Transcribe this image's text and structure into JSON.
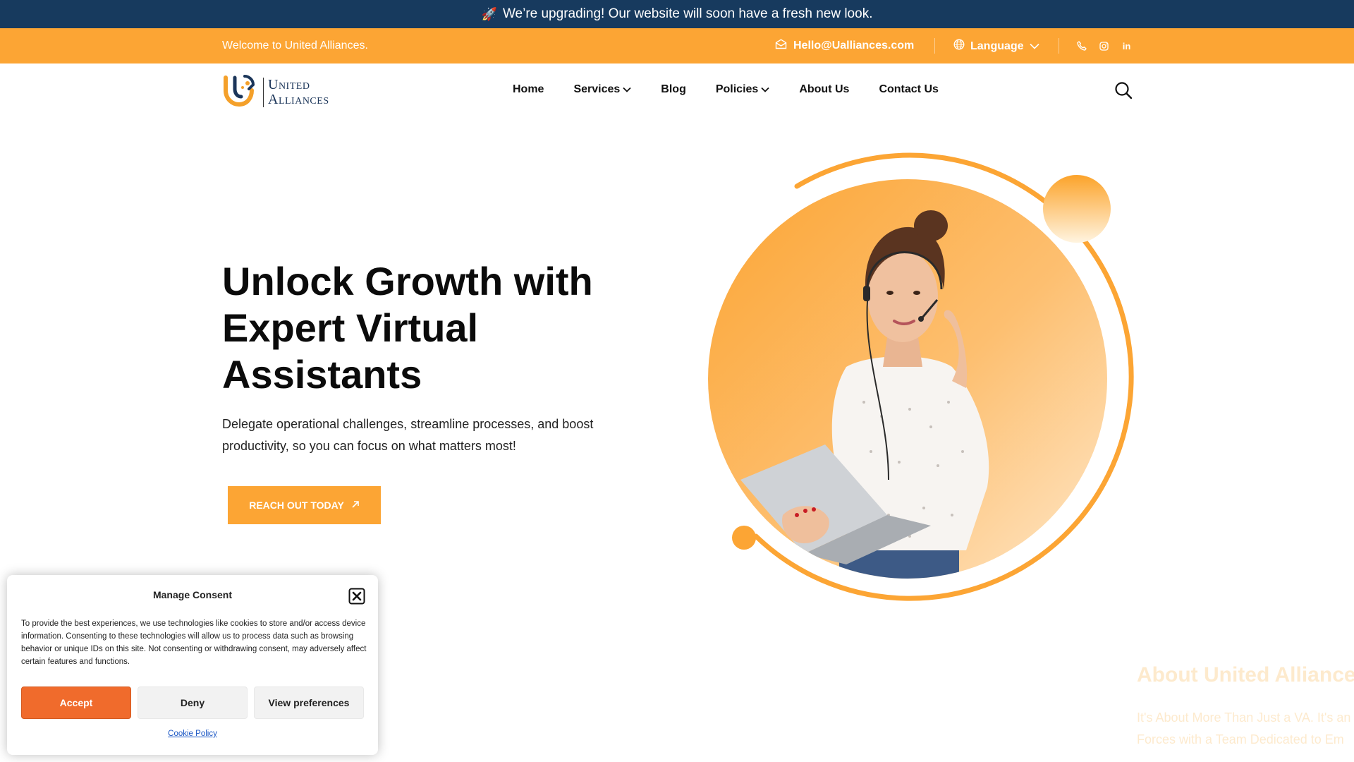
{
  "announcement": {
    "icon": "rocket-icon",
    "text": "We’re upgrading! Our website will soon have a fresh new look."
  },
  "topbar": {
    "welcome": "Welcome to United Alliances.",
    "email": "Hello@Ualliances.com",
    "language": "Language",
    "social": [
      "phone-icon",
      "instagram-icon",
      "linkedin-icon"
    ],
    "linkedin_text": "in"
  },
  "header": {
    "logo_line1": "United",
    "logo_line2": "Alliances",
    "nav": [
      {
        "label": "Home",
        "has_dropdown": false
      },
      {
        "label": "Services",
        "has_dropdown": true
      },
      {
        "label": "Blog",
        "has_dropdown": false
      },
      {
        "label": "Policies",
        "has_dropdown": true
      },
      {
        "label": "About Us",
        "has_dropdown": false
      },
      {
        "label": "Contact Us",
        "has_dropdown": false
      }
    ]
  },
  "hero": {
    "title": "Unlock Growth with Expert Virtual Assistants",
    "description": "Delegate operational challenges, streamline processes, and boost productivity, so you can focus on what matters most!",
    "cta_label": "REACH OUT TODAY"
  },
  "about_preview": {
    "title": "About United Alliances",
    "line1": "It's About More Than Just a VA. It's an",
    "line2": "Forces with a Team Dedicated to Em"
  },
  "consent": {
    "title": "Manage Consent",
    "text": "To provide the best experiences, we use technologies like cookies to store and/or access device information. Consenting to these technologies will allow us to process data such as browsing behavior or unique IDs on this site. Not consenting or withdrawing consent, may adversely affect certain features and functions.",
    "accept": "Accept",
    "deny": "Deny",
    "preferences": "View preferences",
    "policy_link": "Cookie Policy"
  },
  "colors": {
    "announce_bg": "#173a5e",
    "brand_orange": "#fca534",
    "accept_orange": "#f06b2c",
    "navy": "#1b3559"
  }
}
